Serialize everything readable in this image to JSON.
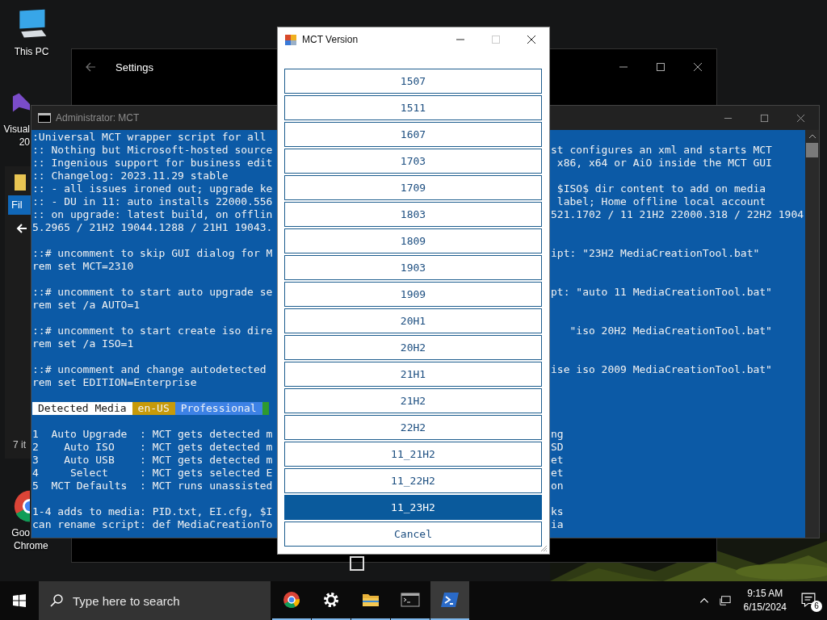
{
  "desktop_icons": [
    {
      "kind": "pc",
      "lines": [
        "This PC"
      ]
    },
    {
      "kind": "studio",
      "lines": [
        "Visual",
        "20"
      ]
    },
    {
      "kind": "chrome",
      "lines": [
        "Goo",
        "Chrome"
      ]
    }
  ],
  "explorer_fragment": {
    "title": "Fil",
    "status": "7 it"
  },
  "settings_window": {
    "title": "Settings",
    "accent_checkbox": {
      "checked": false
    }
  },
  "console": {
    "title": "Administrator: MCT",
    "blocks": [
      {
        "kind": "lines",
        "lines": [
          {
            "left": ":Universal MCT wrapper script for all"
          },
          {
            "left": ":: Nothing but Microsoft-hosted source",
            "right": "st configures an xml and starts MCT"
          },
          {
            "left": ":: Ingenious support for business edit",
            "right": " x86, x64 or AiO inside the MCT GUI"
          },
          {
            "left": ":: Changelog: 2023.11.29 stable"
          },
          {
            "left": ":: - all issues ironed out; upgrade ke",
            "right": " $ISO$ dir content to add on media"
          },
          {
            "left": ":: - DU in 11: auto installs 22000.556",
            "right": " label; Home offline local account"
          },
          {
            "left": ":: on upgrade: latest build, on offlin",
            "right": "521.1702 / 11 21H2 22000.318 / 22H2 1904"
          },
          {
            "left": "5.2965 / 21H2 19044.1288 / 21H1 19043."
          }
        ]
      },
      {
        "kind": "lines",
        "lines": [
          {
            "left": "::# uncomment to skip GUI dialog for M",
            "right": "ipt: \"23H2 MediaCreationTool.bat\""
          },
          {
            "left": "rem set MCT=2310"
          }
        ]
      },
      {
        "kind": "lines",
        "lines": [
          {
            "left": "::# uncomment to start auto upgrade se",
            "right": "pt: \"auto 11 MediaCreationTool.bat\""
          },
          {
            "left": "rem set /a AUTO=1"
          }
        ]
      },
      {
        "kind": "lines",
        "lines": [
          {
            "left": "::# uncomment to start create iso dire",
            "right": "   \"iso 20H2 MediaCreationTool.bat\""
          },
          {
            "left": "rem set /a ISO=1"
          }
        ]
      },
      {
        "kind": "lines",
        "lines": [
          {
            "left": "::# uncomment and change autodetected",
            "right": "ise iso 2009 MediaCreationTool.bat\""
          },
          {
            "left": "rem set EDITION=Enterprise"
          }
        ]
      },
      {
        "kind": "status",
        "segments": [
          {
            "text": "Detected Media",
            "color": "#ffffff"
          },
          {
            "text": "en-US",
            "color": "#c79a0a"
          },
          {
            "text": "Professional",
            "color": "#3d82e6"
          },
          {
            "color": "#2e9a2e"
          }
        ]
      },
      {
        "kind": "lines",
        "lines": [
          {
            "left": "1  Auto Upgrade  : MCT gets detected m",
            "right": "ng"
          },
          {
            "left": "2    Auto ISO    : MCT gets detected m",
            "right": "SD"
          },
          {
            "left": "3    Auto USB    : MCT gets detected m",
            "right": "et"
          },
          {
            "left": "4     Select     : MCT gets selected E",
            "right": "et"
          },
          {
            "left": "5  MCT Defaults  : MCT runs unassisted",
            "right": "on"
          }
        ]
      },
      {
        "kind": "lines",
        "lines": [
          {
            "left": "1-4 adds to media: PID.txt, EI.cfg, $I",
            "right": "ks"
          },
          {
            "left": "can rename script: def MediaCreationTo",
            "right": "ia"
          }
        ]
      }
    ]
  },
  "dialog": {
    "title": "MCT Version",
    "options": [
      {
        "label": "1507",
        "selected": false
      },
      {
        "label": "1511",
        "selected": false
      },
      {
        "label": "1607",
        "selected": false
      },
      {
        "label": "1703",
        "selected": false
      },
      {
        "label": "1709",
        "selected": false
      },
      {
        "label": "1803",
        "selected": false
      },
      {
        "label": "1809",
        "selected": false
      },
      {
        "label": "1903",
        "selected": false
      },
      {
        "label": "1909",
        "selected": false
      },
      {
        "label": "20H1",
        "selected": false
      },
      {
        "label": "20H2",
        "selected": false
      },
      {
        "label": "21H1",
        "selected": false
      },
      {
        "label": "21H2",
        "selected": false
      },
      {
        "label": "22H2",
        "selected": false
      },
      {
        "label": "11_21H2",
        "selected": false
      },
      {
        "label": "11_22H2",
        "selected": false
      },
      {
        "label": "11_23H2",
        "selected": true
      }
    ],
    "cancel": "Cancel"
  },
  "taskbar": {
    "search": {
      "placeholder": "Type here to search"
    },
    "apps": [
      {
        "kind": "chrome",
        "active": false
      },
      {
        "kind": "settings",
        "active": false
      },
      {
        "kind": "folder",
        "active": false
      },
      {
        "kind": "cmd",
        "active": false
      },
      {
        "kind": "powershell",
        "active": true
      }
    ],
    "time": "9:15 AM",
    "date": "6/15/2024",
    "notifications": "6"
  }
}
